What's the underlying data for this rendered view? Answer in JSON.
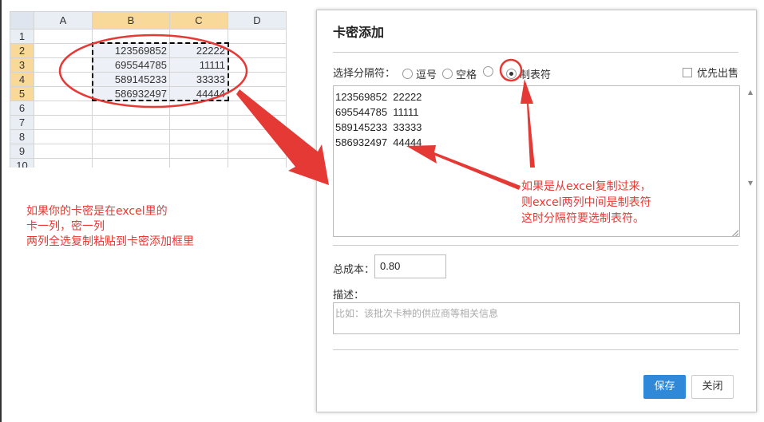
{
  "spreadsheet": {
    "columns": [
      "",
      "A",
      "B",
      "C",
      "D"
    ],
    "rows": [
      {
        "n": "1",
        "b": "",
        "c": ""
      },
      {
        "n": "2",
        "b": "123569852",
        "c": "22222"
      },
      {
        "n": "3",
        "b": "695544785",
        "c": "11111"
      },
      {
        "n": "4",
        "b": "589145233",
        "c": "33333"
      },
      {
        "n": "5",
        "b": "586932497",
        "c": "44444"
      },
      {
        "n": "6",
        "b": "",
        "c": ""
      },
      {
        "n": "7",
        "b": "",
        "c": ""
      },
      {
        "n": "8",
        "b": "",
        "c": ""
      },
      {
        "n": "9",
        "b": "",
        "c": ""
      },
      {
        "n": "10",
        "b": "",
        "c": ""
      }
    ]
  },
  "notes": {
    "left": [
      "如果你的卡密是在excel里的",
      "卡一列，密一列",
      "两列全选复制粘贴到卡密添加框里"
    ],
    "right": [
      "如果是从excel复制过来，",
      "则excel两列中间是制表符",
      "这时分隔符要选制表符。"
    ]
  },
  "dialog": {
    "title": "卡密添加",
    "separator_label": "选择分隔符：",
    "separators": [
      {
        "label": "逗号",
        "checked": false
      },
      {
        "label": "空格",
        "checked": false
      },
      {
        "label": "",
        "checked": false
      },
      {
        "label": "制表符",
        "checked": true
      }
    ],
    "priority_label": "优先出售",
    "priority_checked": false,
    "cards_text": "123569852\t22222\n695544785\t11111\n589145233\t33333\n586932497\t44444",
    "cost_label": "总成本：",
    "cost_value": "0.80",
    "desc_label": "描述：",
    "desc_placeholder": "比如：该批次卡种的供应商等相关信息",
    "save_label": "保存",
    "close_label": "关闭"
  },
  "colors": {
    "annotation": "#e53935",
    "primary_button": "#2f89d8",
    "selected_header": "#f9d99a"
  }
}
